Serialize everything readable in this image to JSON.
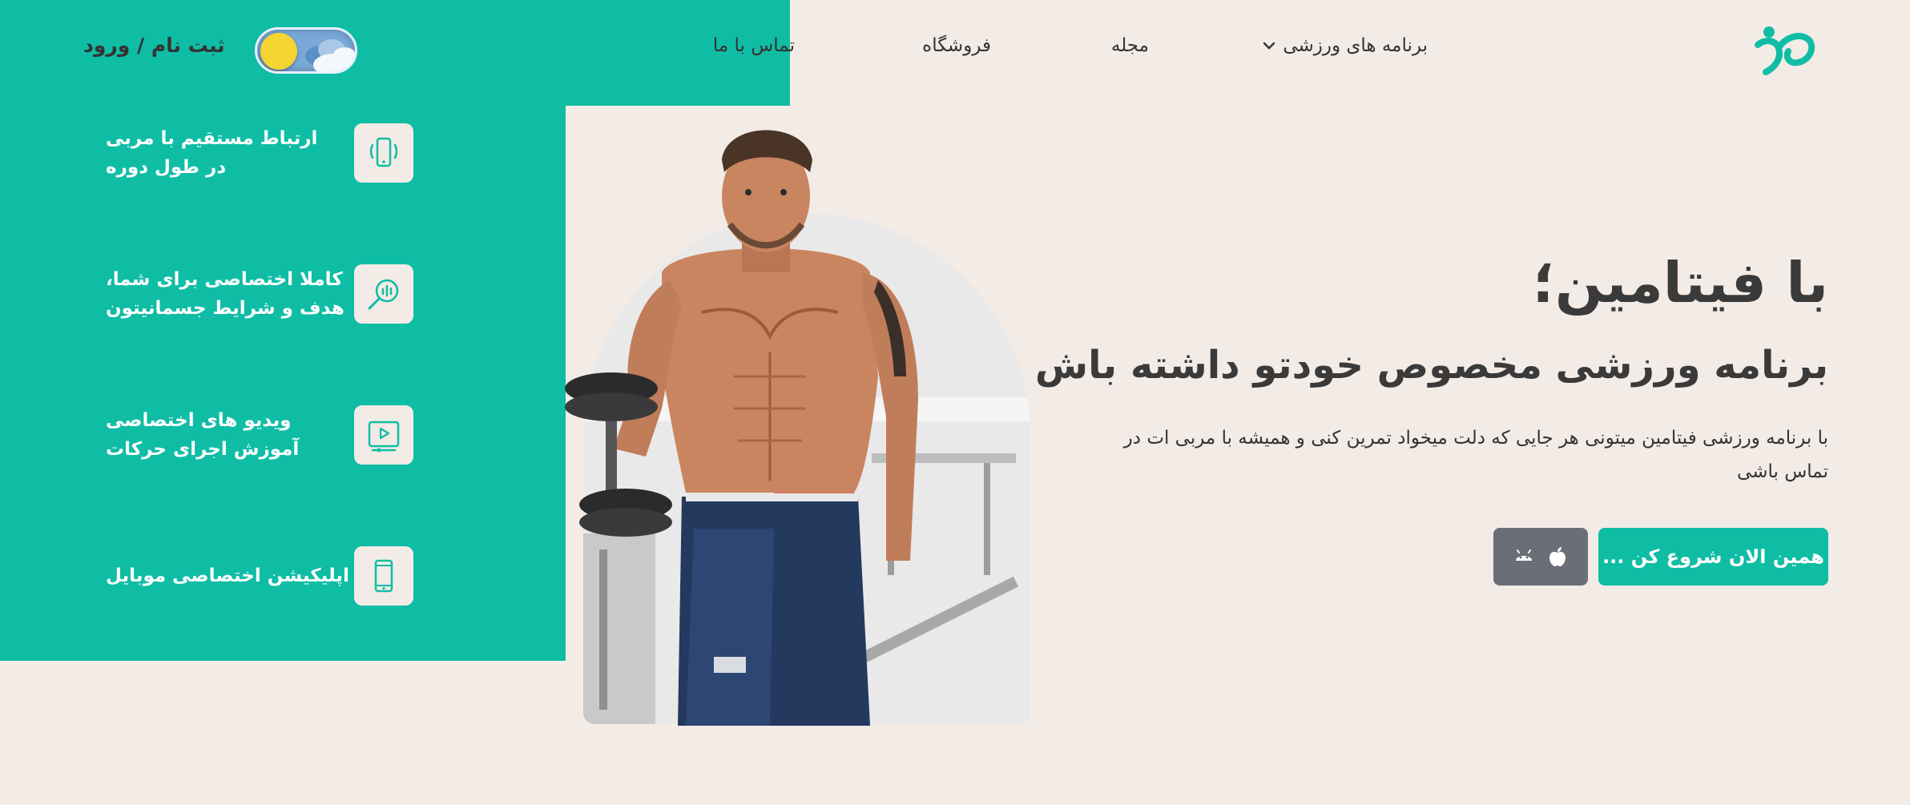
{
  "header": {
    "nav": {
      "programs": "برنامه های ورزشی",
      "magazine": "مجله",
      "shop": "فروشگاه",
      "contact": "تماس با ما"
    },
    "auth": "ثبت نام / ورود"
  },
  "features": [
    {
      "line1": "ارتباط مستقیم با مربی",
      "line2": "در طول دوره",
      "icon": "phone-vibrate-icon"
    },
    {
      "line1": "کاملا اختصاصی برای شما،",
      "line2": "هدف و شرایط جسمانیتون",
      "icon": "search-analytics-icon"
    },
    {
      "line1": "ویدیو های اختصاصی",
      "line2": "آموزش اجرای حرکات",
      "icon": "video-player-icon"
    },
    {
      "line1": "اپلیکیشن اختصاصی موبایل",
      "line2": "",
      "icon": "mobile-phone-icon"
    }
  ],
  "hero": {
    "title": "با فیتامین؛",
    "subtitle": "برنامه ورزشی مخصوص خودتو داشته باش",
    "description": "با برنامه ورزشی فیتامین میتونی هر جایی که دلت میخواد تمرین کنی و همیشه با مربی ات در تماس باشی",
    "cta": "همین الان شروع کن ..."
  },
  "colors": {
    "accent": "#0fbda5",
    "background": "#f3ebe6",
    "text": "#3a3a3a",
    "app_button": "#6b6e76"
  }
}
